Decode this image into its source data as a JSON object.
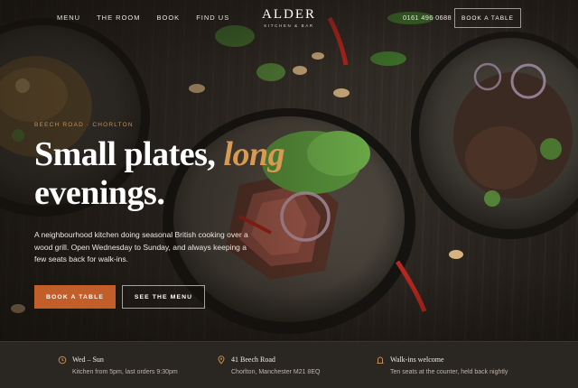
{
  "nav": {
    "links": [
      "MENU",
      "THE ROOM",
      "BOOK",
      "FIND US"
    ],
    "logo_name": "ALDER",
    "logo_sub": "KITCHEN & BAR",
    "phone": "0161 496 0688",
    "cta": "BOOK A TABLE"
  },
  "hero": {
    "eyebrow": "BEECH ROAD · CHORLTON",
    "headline_line1": "Small plates,",
    "headline_accent": "long",
    "headline_line2": "evenings.",
    "description": "A neighbourhood kitchen doing seasonal British cooking over a wood grill. Open Wednesday to Sunday, and always keeping a few seats back for walk-ins.",
    "primary_button": "BOOK A TABLE",
    "secondary_button": "SEE THE MENU"
  },
  "info": [
    {
      "icon": "clock-icon",
      "title": "Wed – Sun",
      "detail": "Kitchen from 5pm, last orders 9:30pm"
    },
    {
      "icon": "map-pin-icon",
      "title": "41 Beech Road",
      "detail": "Chorlton, Manchester M21 8EQ"
    },
    {
      "icon": "door-icon",
      "title": "Walk-ins welcome",
      "detail": "Ten seats at the counter, held back nightly"
    }
  ],
  "colors": {
    "accent": "#c25e29",
    "accent_text": "#d79a52",
    "background": "#1e1a16",
    "info_bar": "#2a2622"
  }
}
